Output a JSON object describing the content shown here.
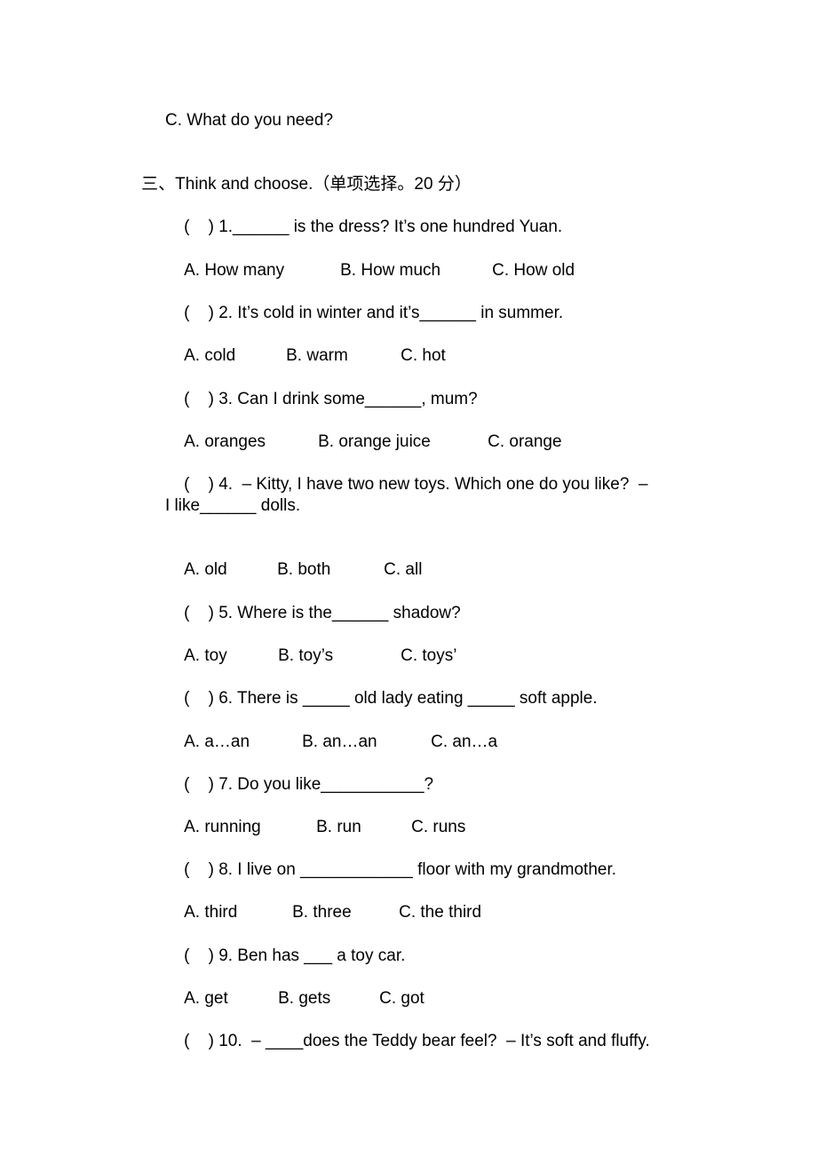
{
  "prev_option": "C. What do you need?",
  "section": {
    "number": "三、",
    "title": "Think and choose.",
    "note": "（单项选择。20 分）"
  },
  "questions": [
    {
      "paren": "(    )",
      "stem": "1.______ is the dress? It’s one hundred Yuan.",
      "options": [
        "A. How many",
        "B. How much",
        "C. How old"
      ]
    },
    {
      "paren": "(    )",
      "stem": "2. It’s cold in winter and it’s______ in summer.",
      "options": [
        "A. cold",
        "B. warm",
        "C. hot"
      ]
    },
    {
      "paren": "(    )",
      "stem": "3. Can I drink some______, mum?",
      "options": [
        "A. oranges",
        "B. orange juice",
        "C. orange"
      ]
    },
    {
      "paren": "(    )",
      "stem": "4.  – Kitty, I have two new toys. Which one do you like?  –",
      "stem_continued": "I like______ dolls.",
      "options": [
        "A. old",
        "B. both",
        "C. all"
      ]
    },
    {
      "paren": "(    )",
      "stem": "5. Where is the______ shadow?",
      "options": [
        "A. toy",
        "B. toy’s",
        "C. toys’"
      ]
    },
    {
      "paren": "(    )",
      "stem": "6. There is _____ old lady eating _____ soft apple.",
      "options": [
        "A. a…an",
        "B. an…an",
        "C. an…a"
      ]
    },
    {
      "paren": "(    )",
      "stem": "7. Do you like___________?",
      "options": [
        "A. running",
        "B. run",
        "C. runs"
      ]
    },
    {
      "paren": "(    )",
      "stem": "8. I live on ____________ floor with my grandmother.",
      "options": [
        "A. third",
        "B. three",
        "C. the third"
      ]
    },
    {
      "paren": "(    )",
      "stem": "9. Ben has ___ a toy car.",
      "options": [
        "A. get",
        "B. gets",
        "C. got"
      ]
    },
    {
      "paren": "(    )",
      "stem": "10.  – ____does the Teddy bear feel?  – It’s soft and fluffy."
    }
  ]
}
